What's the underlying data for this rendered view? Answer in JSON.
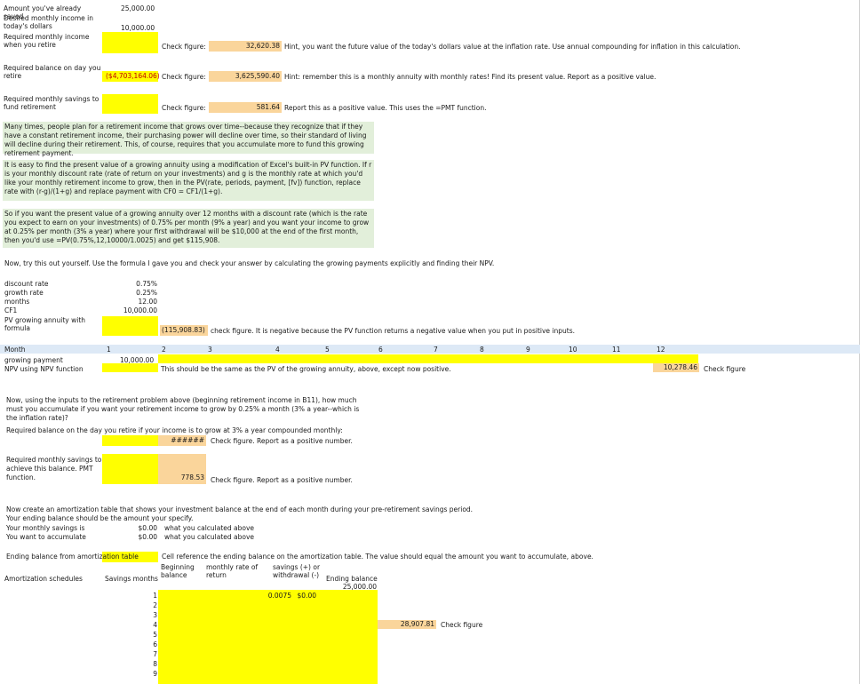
{
  "inputs": {
    "saved_label": "Amount you've already saved",
    "saved_value": "25,000.00",
    "desired_label": "Desired monthly income in today's dollars",
    "desired_value": "10,000.00",
    "required_income_label": "Required monthly income when you retire",
    "check_figure_label": "Check figure:",
    "required_income_check": "32,620.38",
    "hint1": "Hint, you want the future value of the today's dollars value at the inflation rate. Use annual compounding for inflation in this calculation.",
    "required_balance_label": "Required balance on day you retire",
    "required_balance_value": "($4,703,164.06)",
    "required_balance_check": "3,625,590.40",
    "hint2": "Hint: remember this is a monthly annuity with monthly rates! Find its present value. Report as a positive value.",
    "required_savings_label": "Required monthly savings to fund retirement",
    "required_savings_check": "581.64",
    "hint3": "Report this as a positive value. This uses the =PMT function."
  },
  "notes": {
    "p1": "Many times, people plan for a retirement income that grows over time--because they recognize that if they have a constant retirement income, their purchasing power will decline over time, so their standard of living will decline during their retirement. This, of course, requires that you accumulate more to fund this growing retirement payment.",
    "p2": "It is easy to find the present value of a growing annuity using a modification of Excel's built-in PV function. If r is your monthly discount rate (rate of return on your investments) and g is the monthly rate at which you'd like your monthly retirement income to grow, then in the PV(rate, periods, payment, [fv]) function, replace rate with (r-g)/(1+g) and replace payment with CF0 = CF1/(1+g).",
    "p3": "So if you want the present value of a growing annuity over 12 months with a discount rate (which is the rate you expect to earn on your investments) of 0.75% per month (9% a year) and you want your income to grow at 0.25% per month (3% a year) where your first withdrawal will be $10,000 at the end of the first month, then you'd use =PV(0.75%,12,10000/1.0025) and get $115,908.",
    "p4": "Now, try this out yourself. Use the formula I gave you and check your answer by calculating the growing payments explicitly and finding their NPV."
  },
  "growing": {
    "discount_label": "discount rate",
    "discount_value": "0.75%",
    "growth_label": "growth rate",
    "growth_value": "0.25%",
    "months_label": "months",
    "months_value": "12.00",
    "cf1_label": "CF1",
    "cf1_value": "10,000.00",
    "pv_label": "PV growing annuity with formula",
    "pv_value": "(115,908.83)",
    "pv_note": "check figure. It is negative because the PV function returns a negative value when you put in positive inputs."
  },
  "month_row": {
    "label": "Month",
    "months": [
      "1",
      "2",
      "3",
      "4",
      "5",
      "6",
      "7",
      "8",
      "9",
      "10",
      "11",
      "12"
    ],
    "payment_label": "growing payment",
    "payment_first": "10,000.00",
    "npv_label": "NPV using NPV function",
    "npv_note": "This should be the same as the PV of the growing annuity, above, except now positive.",
    "npv_check": "10,278.46",
    "check_label": "Check figure"
  },
  "growth_problem": {
    "question": "Now, using the inputs to the retirement problem above (beginning retirement income in B11), how much must you accumulate if you want your retirement income to grow by 0.25% a month (3% a year--which is the inflation rate)?",
    "balance_label": "Required balance on the day you retire if your income is to grow at 3% a year compounded monthly:",
    "balance_check": "######",
    "balance_note": "Check figure. Report as a positive number.",
    "savings_label": "Required monthly savings to achieve this balance. PMT function.",
    "savings_check": "778.53",
    "savings_note": "Check figure. Report as a positive number."
  },
  "amortization": {
    "intro": "Now create an amortization table that shows your investment balance at the end of each month during your pre-retirement savings period.",
    "intro2": "Your ending balance should be the amount your specify.",
    "savings_label": "Your monthly savings is",
    "savings_value": "$0.00",
    "savings_note": "what you calculated above",
    "accumulate_label": "You want to accumulate",
    "accumulate_value": "$0.00",
    "accumulate_note": "what you calculated above",
    "ending_label": "Ending balance from amortization table",
    "ending_note": "Cell reference the ending balance on the amortization table. The value should equal the amount you want to accumulate, above.",
    "schedules_label": "Amortization schedules",
    "col_months": "Savings months",
    "col_begin": "Beginning balance",
    "col_rate": "monthly rate of return",
    "col_savings": "savings (+) or withdrawal (-)",
    "col_end": "Ending balance",
    "start_balance": "25,000.00",
    "rate_value": "0.0075",
    "savings_cell": "$0.00",
    "rows": [
      "1",
      "2",
      "3",
      "4",
      "5",
      "6",
      "7",
      "8",
      "9"
    ],
    "check_value": "28,907.81",
    "check_label": "Check figure"
  }
}
